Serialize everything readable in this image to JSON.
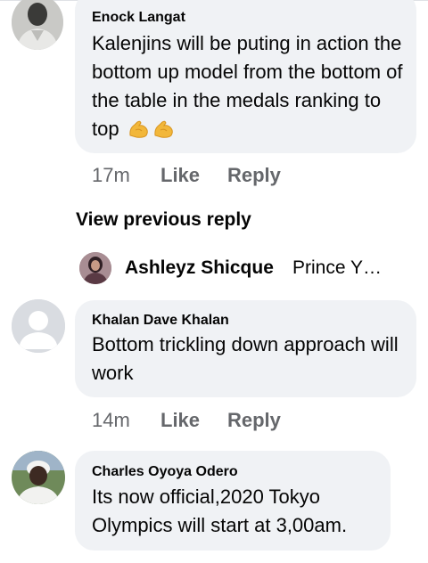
{
  "comments": [
    {
      "author": "Enock Langat",
      "text": "Kalenjins  will be puting in action the bottom up model from the bottom of the table in the medals ranking to top",
      "emoji": [
        "flexed-biceps",
        "flexed-biceps"
      ],
      "time": "17m",
      "like_label": "Like",
      "reply_label": "Reply"
    },
    {
      "author": "Khalan Dave Khalan",
      "text": "Bottom trickling down approach will work",
      "time": "14m",
      "like_label": "Like",
      "reply_label": "Reply"
    },
    {
      "author": "Charles Oyoya Odero",
      "text": "Its now official,2020 Tokyo Olympics will start at 3,00am."
    }
  ],
  "view_previous_reply": "View previous reply",
  "reply_preview": {
    "author": "Ashleyz Shicque",
    "snippet": "Prince Y…"
  },
  "colors": {
    "bubble": "#f0f2f5",
    "secondary_text": "#65676b",
    "primary_text": "#050505"
  }
}
